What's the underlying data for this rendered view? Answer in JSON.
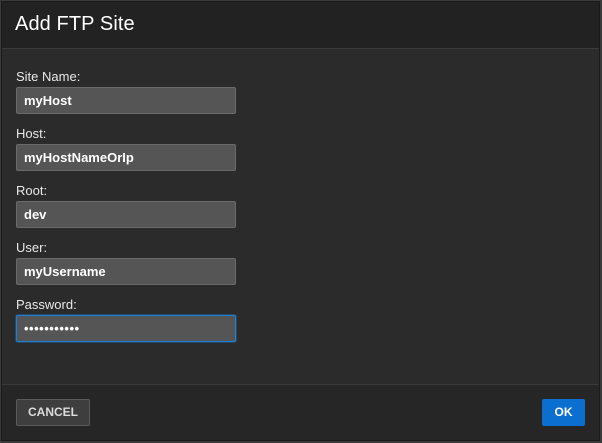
{
  "dialog": {
    "title": "Add FTP Site"
  },
  "form": {
    "site_name": {
      "label": "Site Name:",
      "value": "myHost"
    },
    "host": {
      "label": "Host:",
      "value": "myHostNameOrIp"
    },
    "root": {
      "label": "Root:",
      "value": "dev"
    },
    "user": {
      "label": "User:",
      "value": "myUsername"
    },
    "password": {
      "label": "Password:",
      "value": "•••••••••••"
    }
  },
  "footer": {
    "cancel_label": "CANCEL",
    "ok_label": "OK"
  },
  "colors": {
    "accent": "#0a6fcf",
    "background": "#2b2b2b",
    "input_background": "#555555"
  }
}
